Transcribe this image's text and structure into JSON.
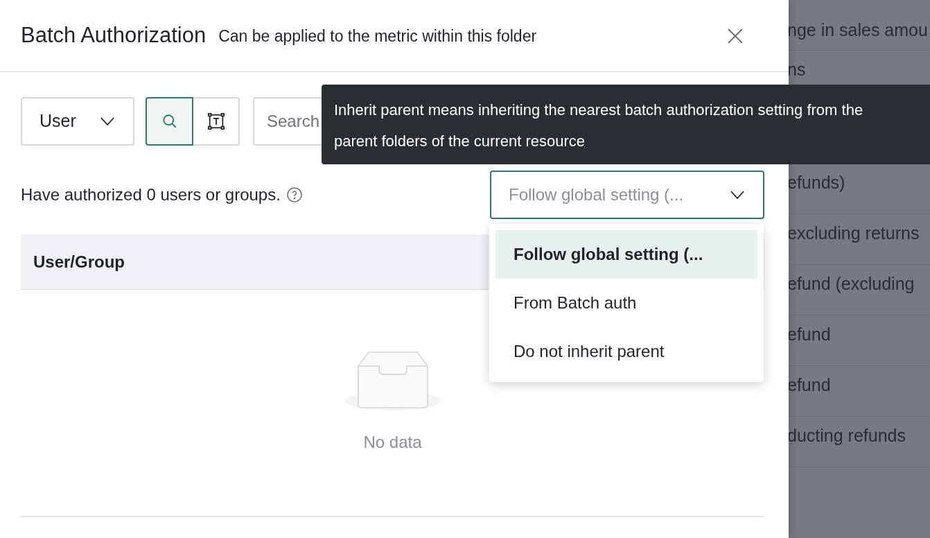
{
  "drawer": {
    "title": "Batch Authorization",
    "subtitle": "Can be applied to the metric within this folder"
  },
  "toolbar": {
    "type_select": {
      "value": "User"
    },
    "mode_toggle": [
      {
        "kind": "search",
        "selected": true
      },
      {
        "kind": "text",
        "selected": false
      }
    ],
    "search": {
      "placeholder": "Search"
    }
  },
  "summary": "Have authorized 0 users or groups.",
  "inherit_select": {
    "value": "Follow global setting (...",
    "expanded": true,
    "options": [
      {
        "label": "Follow global setting (...",
        "selected": true
      },
      {
        "label": "From Batch auth",
        "selected": false
      },
      {
        "label": "Do not inherit parent",
        "selected": false
      }
    ]
  },
  "table": {
    "columns": [
      "User/Group"
    ],
    "empty_text": "No data"
  },
  "tooltip": "Inherit parent means inheriting the nearest batch authorization setting from the parent folders of the current resource",
  "background_list": [
    "nge in sales amou",
    "ns",
    "efunds)",
    "excluding returns",
    "efund (excluding",
    "efund",
    "efund",
    "ducting refunds"
  ]
}
